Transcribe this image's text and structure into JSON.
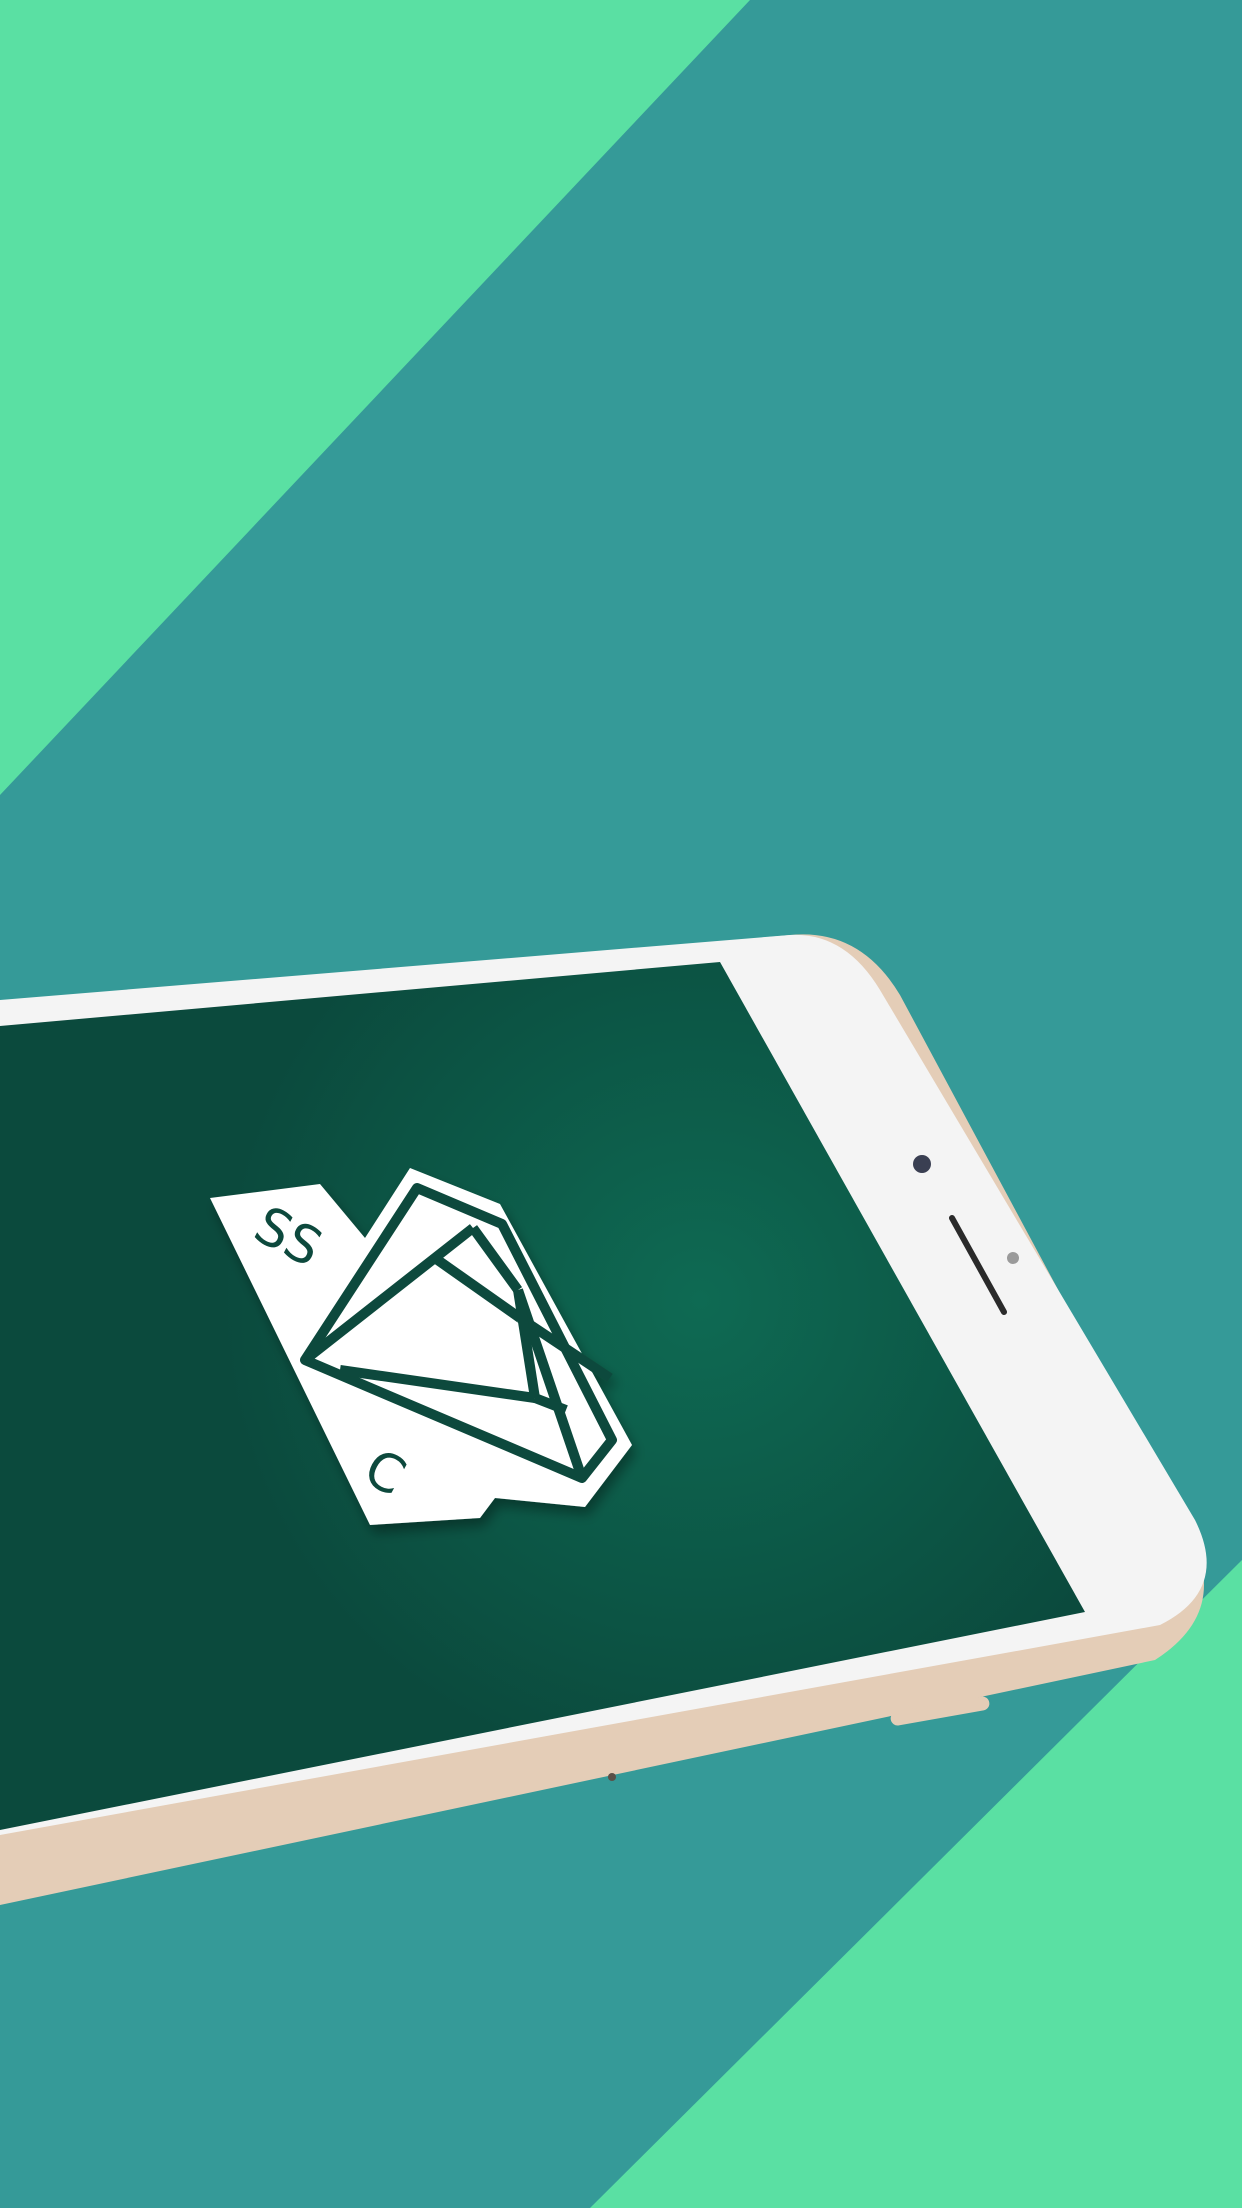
{
  "background": {
    "teal": "#359a98",
    "mint": "#5ae0a3"
  },
  "device": {
    "type": "smartphone",
    "color": "white-and-gold",
    "frame_color": "#f4f4f4",
    "edge_color": "#e4cdb7",
    "screen": {
      "background_center": "#0e6a53",
      "background_edge": "#0b4a3d",
      "logo": {
        "name": "ssc-diamond-logo",
        "letters_top": "SS",
        "letter_bottom": "C",
        "badge_color": "#ffffff",
        "ink_color": "#0c4a3c"
      }
    }
  }
}
